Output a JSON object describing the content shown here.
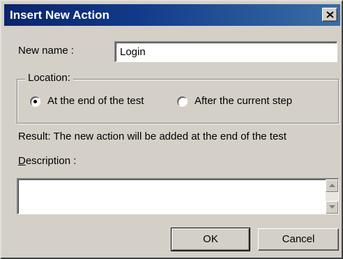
{
  "window": {
    "title": "Insert New Action",
    "close_label": "close"
  },
  "name_field": {
    "label": "New name :",
    "value": "Login"
  },
  "location": {
    "legend": "Location:",
    "options": [
      {
        "label": "At the end of the test",
        "selected": true
      },
      {
        "label": "After the current step",
        "selected": false
      }
    ]
  },
  "result_text": "Result: The new action will be added at the end of the test",
  "description": {
    "label_accel": "D",
    "label_rest": "escription :",
    "value": ""
  },
  "buttons": {
    "ok": "OK",
    "cancel": "Cancel"
  },
  "colors": {
    "titlebar_start": "#0a246a",
    "titlebar_end": "#3a6ea5",
    "dialog_bg": "#d4d0c8"
  },
  "icons": {
    "close": "close-icon",
    "scroll_up": "arrow-up-icon",
    "scroll_down": "arrow-down-icon"
  }
}
